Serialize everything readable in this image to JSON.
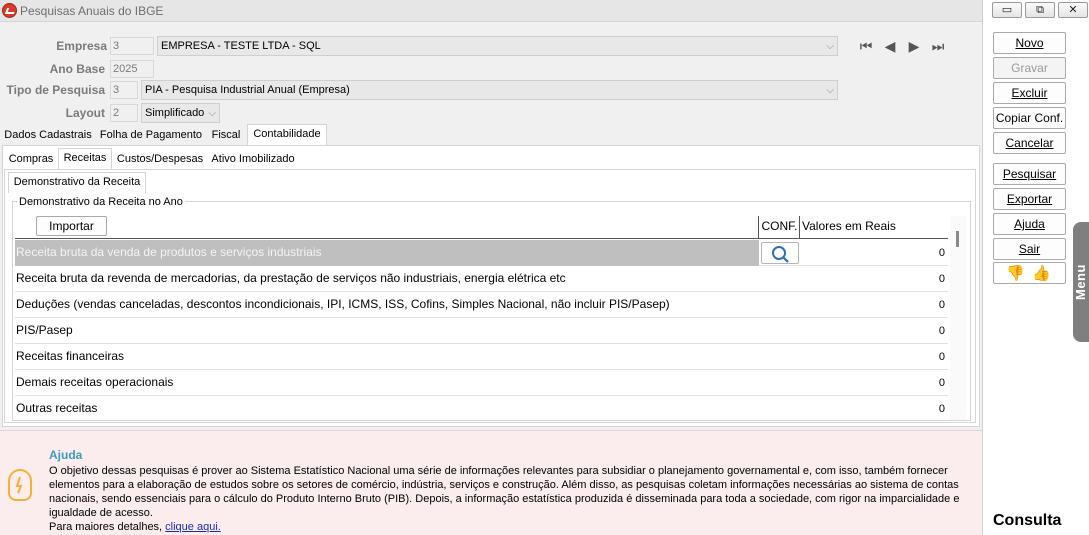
{
  "window": {
    "title": "Pesquisas Anuais do IBGE",
    "buttons": [
      "▭",
      "⧉",
      "✕"
    ]
  },
  "form": {
    "empresa": {
      "label": "Empresa",
      "code": "3",
      "value": "EMPRESA - TESTE LTDA - SQL"
    },
    "ano_base": {
      "label": "Ano Base",
      "value": "2025"
    },
    "tipo_pesquisa": {
      "label": "Tipo de Pesquisa",
      "code": "3",
      "value": "PIA - Pesquisa Industrial Anual (Empresa)"
    },
    "layout": {
      "label": "Layout",
      "code": "2",
      "value": "Simplificado"
    }
  },
  "record_nav": {
    "first": "⏮",
    "prev": "◀",
    "next": "▶",
    "last": "⏭"
  },
  "tabs_main": [
    "Dados Cadastrais",
    "Folha de Pagamento",
    "Fiscal",
    "Contabilidade"
  ],
  "tabs_sub": [
    "Compras",
    "Receitas",
    "Custos/Despesas",
    "Ativo Imobilizado"
  ],
  "tabs_inner": [
    "Demonstrativo da Receita"
  ],
  "group_title": "Demonstrativo da Receita no Ano",
  "grid": {
    "import_label": "Importar",
    "col_conf": "CONF.",
    "col_value": "Valores em Reais",
    "rows": [
      {
        "desc": "Receita bruta da venda de produtos e serviços industriais",
        "value": "0"
      },
      {
        "desc": "Receita bruta da revenda de mercadorias, da prestação de serviços não industriais, energia elétrica etc",
        "value": "0"
      },
      {
        "desc": "Deduções (vendas canceladas, descontos incondicionais, IPI, ICMS, ISS, Cofins, Simples Nacional, não incluir PIS/Pasep)",
        "value": "0"
      },
      {
        "desc": "PIS/Pasep",
        "value": "0"
      },
      {
        "desc": "Receitas financeiras",
        "value": "0"
      },
      {
        "desc": "Demais receitas operacionais",
        "value": "0"
      },
      {
        "desc": "Outras receitas",
        "value": "0"
      }
    ]
  },
  "help": {
    "title": "Ajuda",
    "text": "O objetivo dessas pesquisas é prover ao Sistema Estatístico Nacional uma série de informações relevantes para subsidiar o planejamento governamental e, com isso, também fornecer elementos para a elaboração de estudos sobre os setores de comércio, indústria, serviços e construção. Além disso, as pesquisas coletam informações necessárias ao sistema de contas nacionais, sendo essenciais para o cálculo do Produto Interno Bruto (PIB). Depois, a informação estatística produzida é disseminada para toda a sociedade, com rigor na imparcialidade e igualdade de acesso.",
    "more_prefix": "Para maiores detalhes, ",
    "link": "clique aqui."
  },
  "actions": {
    "novo": "Novo",
    "gravar": "Gravar",
    "excluir": "Excluir",
    "copiar": "Copiar Conf.",
    "cancelar": "Cancelar",
    "pesquisar": "Pesquisar",
    "exportar": "Exportar",
    "ajuda": "Ajuda",
    "sair": "Sair"
  },
  "side_menu_label": "Menu",
  "mode_label": "Consulta"
}
